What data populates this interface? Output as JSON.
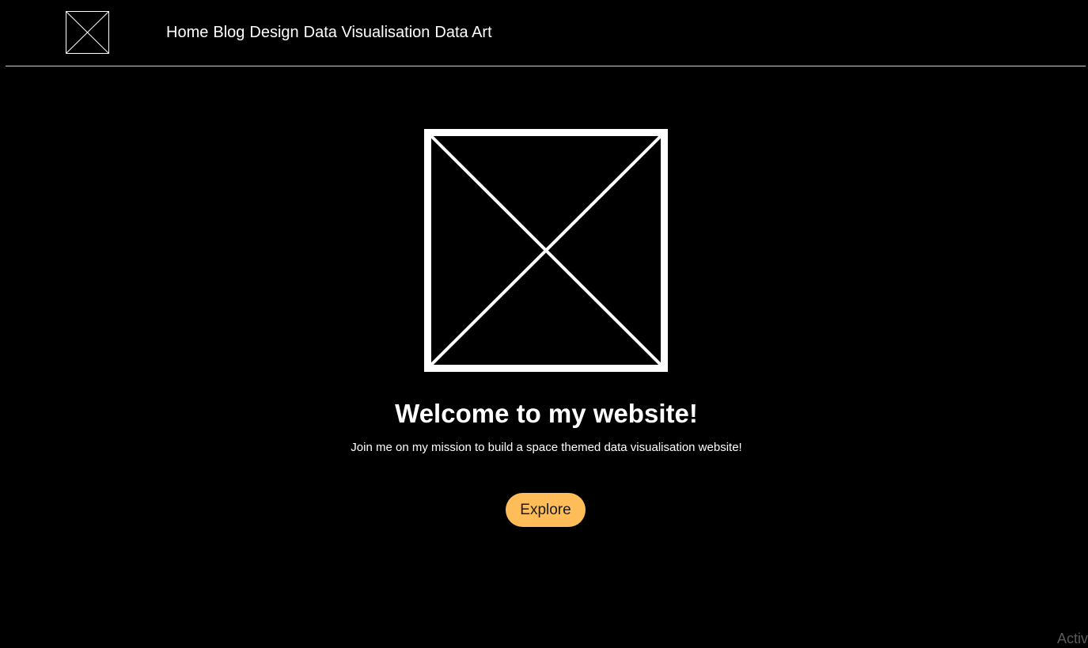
{
  "header": {
    "logo_icon": "image-placeholder-icon",
    "nav_items": [
      "Home",
      "Blog",
      "Design",
      "Data Visualisation",
      "Data Art"
    ]
  },
  "hero": {
    "image_icon": "image-placeholder-icon",
    "title": "Welcome to my website!",
    "subtitle": "Join me on my mission to build a space themed data visualisation website!",
    "button_label": "Explore"
  },
  "watermark": {
    "text": "Activ"
  },
  "colors": {
    "background": "#000000",
    "text": "#ffffff",
    "button": "#ffbd59",
    "divider": "#cfcfcf"
  }
}
